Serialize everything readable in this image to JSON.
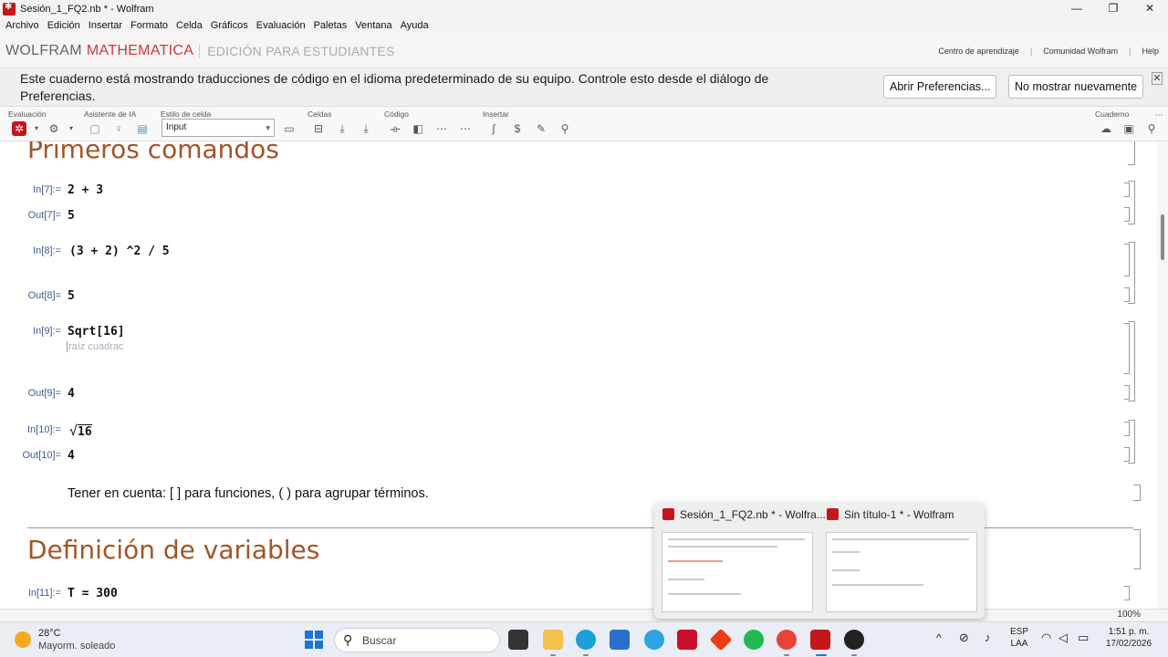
{
  "window": {
    "title": "Sesión_1_FQ2.nb * - Wolfram",
    "controls": [
      "—",
      "❐",
      "✕"
    ]
  },
  "menu": [
    "Archivo",
    "Edición",
    "Insertar",
    "Formato",
    "Celda",
    "Gráficos",
    "Evaluación",
    "Paletas",
    "Ventana",
    "Ayuda"
  ],
  "brand": {
    "wolfram": "WOLFRAM",
    "mathematica": "MATHEMATICA",
    "edition": "EDICIÓN PARA ESTUDIANTES",
    "links": [
      "Centro de aprendizaje",
      "Comunidad Wolfram",
      "Help"
    ]
  },
  "notice": {
    "message": "Este cuaderno está mostrando traducciones de código en el idioma predeterminado de su equipo. Controle esto desde el diálogo de Preferencias.",
    "btn_prefs": "Abrir Preferencias...",
    "btn_dismiss": "No mostrar nuevamente",
    "close": "✕"
  },
  "toolbar": {
    "groups": [
      "Evaluación",
      "Asistente de IA",
      "Estilo de celda",
      "Celdas",
      "Código",
      "Insertar",
      "Cuaderno"
    ],
    "style_value": "Input"
  },
  "notebook": {
    "section1": "Primeros comandos",
    "cells": [
      {
        "in_label": "In[7]:=",
        "input": "2 + 3",
        "out_label": "Out[7]=",
        "output": "5"
      },
      {
        "in_label": "In[8]:=",
        "input": "(3 + 2) ^2 / 5",
        "out_label": "Out[8]=",
        "output": "5"
      },
      {
        "in_label": "In[9]:=",
        "input": "Sqrt[16]",
        "hint": "raíz cuadrac",
        "out_label": "Out[9]=",
        "output": "4"
      },
      {
        "in_label": "In[10]:=",
        "input": "16",
        "out_label": "Out[10]=",
        "output": "4"
      }
    ],
    "note": "Tener en cuenta: [ ] para funciones, ( ) para agrupar términos.",
    "section2": "Definición de variables",
    "cell11": {
      "in_label": "In[11]:=",
      "input": "T = 300"
    }
  },
  "status": {
    "zoom": "100%"
  },
  "preview": {
    "items": [
      "Sesión_1_FQ2.nb * - Wolfra...",
      "Sin título-1 * - Wolfram"
    ]
  },
  "taskbar": {
    "weather_temp": "28°C",
    "weather_desc": "Mayorm. soleado",
    "search_placeholder": "Buscar",
    "lang1": "ESP",
    "lang2": "LAA",
    "time": "1:51 p. m.",
    "date": "17/02/2026"
  },
  "colors": {
    "section": "#a55328",
    "label": "#3d5d95",
    "brand_red": "#d1363a"
  }
}
